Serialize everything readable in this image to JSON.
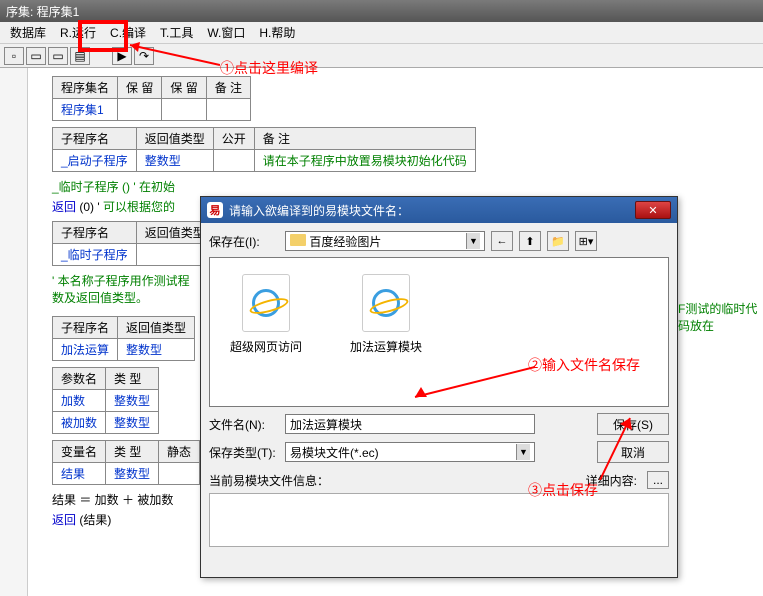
{
  "window": {
    "title": "序集: 程序集1"
  },
  "menu": {
    "db": "数据库",
    "run": "R.运行",
    "compile": "C.编译",
    "tools": "T.工具",
    "window": "W.窗口",
    "help": "H.帮助"
  },
  "annotations": {
    "a1": "①点击这里编译",
    "a2": "②输入文件名保存",
    "a3": "③点击保存"
  },
  "tables": {
    "t1": {
      "h1": "程序集名",
      "h2": "保 留",
      "h3": "保 留",
      "h4": "备 注",
      "r1c1": "程序集1"
    },
    "t2": {
      "h1": "子程序名",
      "h2": "返回值类型",
      "h3": "公开",
      "h4": "备 注",
      "r1c1": "_启动子程序",
      "r1c2": "整数型",
      "r1c4": "请在本子程序中放置易模块初始化代码"
    },
    "code1": "_临时子程序 ()  ' 在初始",
    "code2_a": "返回",
    "code2_b": "(0)  ' ",
    "code2_c": "可以根据您的",
    "t3": {
      "h1": "子程序名",
      "h2": "返回值类型",
      "r1c1": "_临时子程序"
    },
    "comment3": "' 本名称子程序用作测试程\n数及返回值类型。",
    "t4": {
      "h1": "子程序名",
      "h2": "返回值类型",
      "r1c1": "加法运算",
      "r1c2": "整数型"
    },
    "t5": {
      "h1": "参数名",
      "h2": "类 型",
      "r1c1": "加数",
      "r1c2": "整数型",
      "r2c1": "被加数",
      "r2c2": "整数型"
    },
    "t6": {
      "h1": "变量名",
      "h2": "类 型",
      "h3": "静态",
      "r1c1": "结果",
      "r1c2": "整数型"
    },
    "code3": "结果 ＝ 加数 ＋ 被加数",
    "code4_a": "返回",
    "code4_b": "(结果)"
  },
  "side_text": "F测试的临时代码放在",
  "dialog": {
    "title": "请输入欲编译到的易模块文件名：",
    "save_in_label": "保存在(I):",
    "save_in_value": "百度经验图片",
    "files": {
      "f1": "超级网页访问",
      "f2": "加法运算模块"
    },
    "filename_label": "文件名(N):",
    "filename_value": "加法运算模块",
    "filetype_label": "保存类型(T):",
    "filetype_value": "易模块文件(*.ec)",
    "save_btn": "保存(S)",
    "cancel_btn": "取消",
    "info_label": "当前易模块文件信息：",
    "detail_label": "详细内容:",
    "dots": "..."
  }
}
